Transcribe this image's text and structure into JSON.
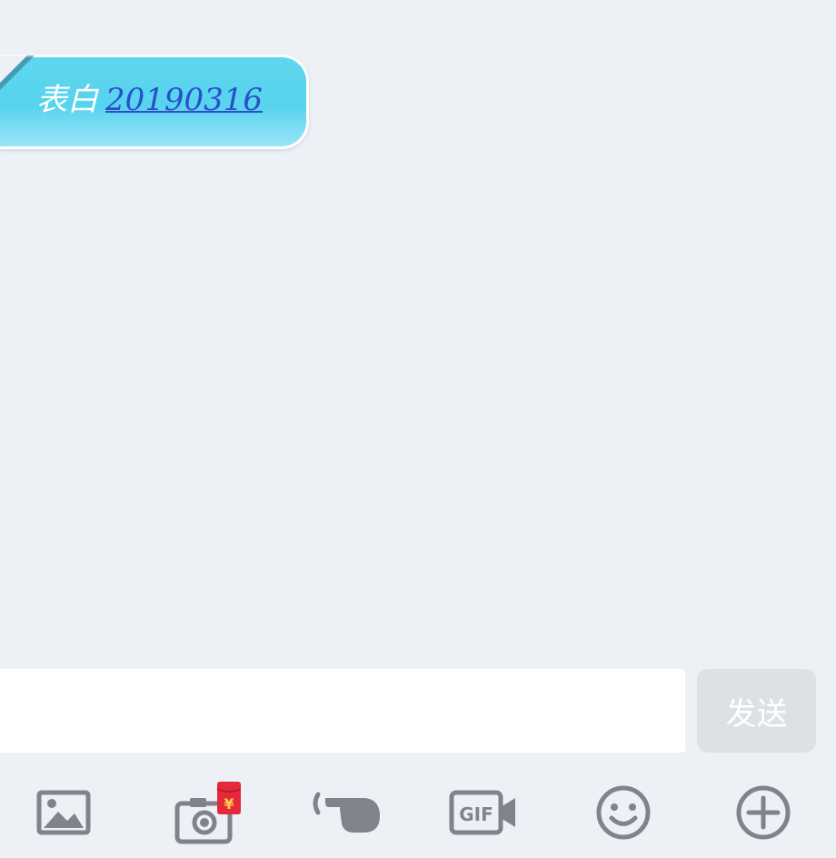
{
  "chat": {
    "messages": [
      {
        "text": "表白",
        "link_text": "20190316"
      }
    ]
  },
  "composer": {
    "input_value": "",
    "input_placeholder": "",
    "send_label": "发送"
  },
  "toolbar": {
    "items": [
      {
        "icon": "image-icon"
      },
      {
        "icon": "camera-redpacket-icon",
        "badge": "¥"
      },
      {
        "icon": "poke-hand-icon"
      },
      {
        "icon": "gif-video-icon",
        "label": "GIF"
      },
      {
        "icon": "smiley-icon"
      },
      {
        "icon": "plus-circle-icon"
      }
    ]
  },
  "colors": {
    "background": "#edf1f6",
    "bubble": "#5fd7ee",
    "link": "#2950c8",
    "icon": "#7f838b",
    "badge": "#e5283a",
    "send_disabled": "#dde1e6"
  }
}
